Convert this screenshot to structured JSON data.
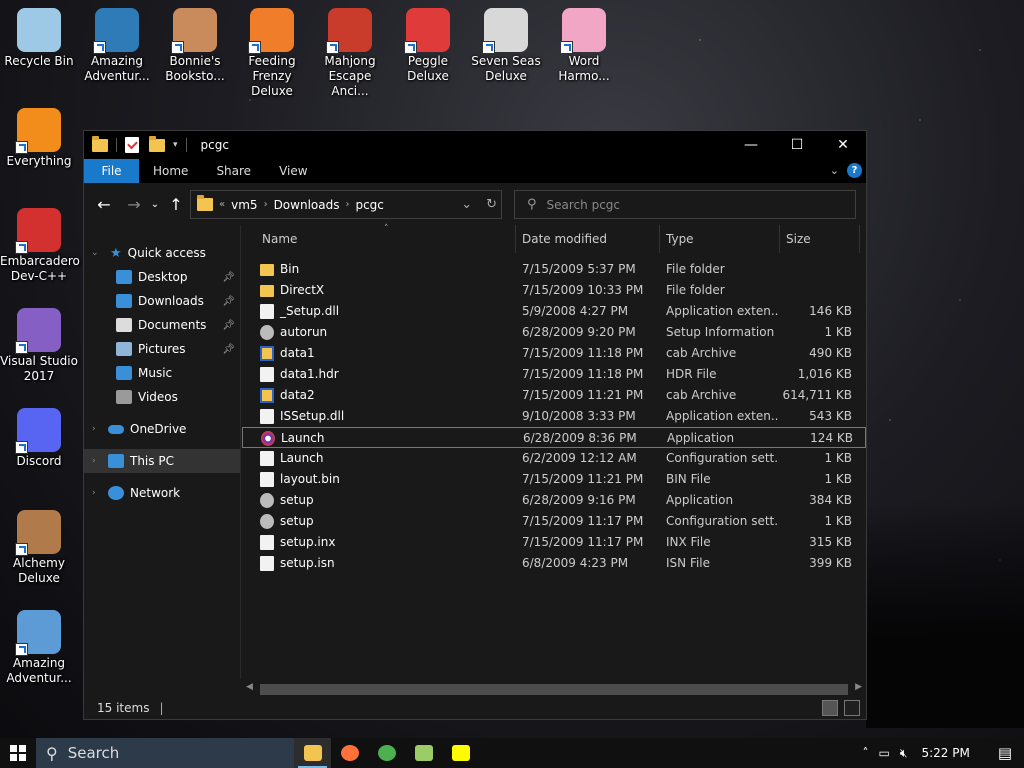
{
  "desktop": {
    "icons": [
      {
        "label": "Recycle Bin",
        "color": "#9ec9e6"
      },
      {
        "label": "Amazing Adventur...",
        "color": "#2f7bb8"
      },
      {
        "label": "Bonnie's Booksto...",
        "color": "#c98b5b"
      },
      {
        "label": "Feeding Frenzy Deluxe",
        "color": "#f07d2a"
      },
      {
        "label": "Mahjong Escape Anci...",
        "color": "#c93c2b"
      },
      {
        "label": "Peggle Deluxe",
        "color": "#e03b3b"
      },
      {
        "label": "Seven Seas Deluxe",
        "color": "#d8d8d8"
      },
      {
        "label": "Word Harmo...",
        "color": "#f0a6c4"
      },
      {
        "label": "Everything",
        "color": "#f28c1b"
      },
      {
        "label": "Embarcadero Dev-C++",
        "color": "#d33030"
      },
      {
        "label": "Visual Studio 2017",
        "color": "#865fc5"
      },
      {
        "label": "Discord",
        "color": "#5865f2"
      },
      {
        "label": "Alchemy Deluxe",
        "color": "#b07a4a"
      },
      {
        "label": "Amazing Adventur...",
        "color": "#5c9bd6"
      }
    ]
  },
  "window": {
    "title": "pcgc",
    "ribbon_tabs": [
      "File",
      "Home",
      "Share",
      "View"
    ],
    "address": {
      "crumbs": [
        "vm5",
        "Downloads",
        "pcgc"
      ]
    },
    "search_placeholder": "Search pcgc",
    "nav": {
      "quick_access": "Quick access",
      "pinned": [
        {
          "label": "Desktop",
          "color": "#3a8fd9"
        },
        {
          "label": "Downloads",
          "color": "#3a8fd9"
        },
        {
          "label": "Documents",
          "color": "#dcdcdc"
        },
        {
          "label": "Pictures",
          "color": "#8fb6d9"
        }
      ],
      "others": [
        {
          "label": "Music",
          "color": "#3a8fd9"
        },
        {
          "label": "Videos",
          "color": "#9a9a9a"
        }
      ],
      "onedrive": "OneDrive",
      "this_pc": "This PC",
      "network": "Network"
    },
    "columns": {
      "name": "Name",
      "date": "Date modified",
      "type": "Type",
      "size": "Size"
    },
    "files": [
      {
        "name": "Bin",
        "date": "7/15/2009 5:37 PM",
        "type": "File folder",
        "size": "",
        "icon": "folder"
      },
      {
        "name": "DirectX",
        "date": "7/15/2009 10:33 PM",
        "type": "File folder",
        "size": "",
        "icon": "folder"
      },
      {
        "name": "_Setup.dll",
        "date": "5/9/2008 4:27 PM",
        "type": "Application exten...",
        "size": "146 KB",
        "icon": "doc"
      },
      {
        "name": "autorun",
        "date": "6/28/2009 9:20 PM",
        "type": "Setup Information",
        "size": "1 KB",
        "icon": "gear"
      },
      {
        "name": "data1",
        "date": "7/15/2009 11:18 PM",
        "type": "cab Archive",
        "size": "490 KB",
        "icon": "cab"
      },
      {
        "name": "data1.hdr",
        "date": "7/15/2009 11:18 PM",
        "type": "HDR File",
        "size": "1,016 KB",
        "icon": "doc"
      },
      {
        "name": "data2",
        "date": "7/15/2009 11:21 PM",
        "type": "cab Archive",
        "size": "614,711 KB",
        "icon": "cab"
      },
      {
        "name": "ISSetup.dll",
        "date": "9/10/2008 3:33 PM",
        "type": "Application exten...",
        "size": "543 KB",
        "icon": "doc"
      },
      {
        "name": "Launch",
        "date": "6/28/2009 8:36 PM",
        "type": "Application",
        "size": "124 KB",
        "icon": "app"
      },
      {
        "name": "Launch",
        "date": "6/2/2009 12:12 AM",
        "type": "Configuration sett...",
        "size": "1 KB",
        "icon": "doc"
      },
      {
        "name": "layout.bin",
        "date": "7/15/2009 11:21 PM",
        "type": "BIN File",
        "size": "1 KB",
        "icon": "doc"
      },
      {
        "name": "setup",
        "date": "6/28/2009 9:16 PM",
        "type": "Application",
        "size": "384 KB",
        "icon": "gear"
      },
      {
        "name": "setup",
        "date": "7/15/2009 11:17 PM",
        "type": "Configuration sett...",
        "size": "1 KB",
        "icon": "gear"
      },
      {
        "name": "setup.inx",
        "date": "7/15/2009 11:17 PM",
        "type": "INX File",
        "size": "315 KB",
        "icon": "doc"
      },
      {
        "name": "setup.isn",
        "date": "6/8/2009 4:23 PM",
        "type": "ISN File",
        "size": "399 KB",
        "icon": "doc"
      }
    ],
    "status": "15 items"
  },
  "taskbar": {
    "search_label": "Search",
    "clock": "5:22 PM",
    "apps": [
      {
        "name": "file-explorer",
        "color": "#f4c451"
      },
      {
        "name": "firefox",
        "color": "#ff7139"
      },
      {
        "name": "chrome",
        "color": "#4caf50"
      },
      {
        "name": "notepad-plus",
        "color": "#9ccc65"
      },
      {
        "name": "snapchat",
        "color": "#fffc00"
      }
    ]
  },
  "colors": {
    "accent": "#1979ca"
  }
}
